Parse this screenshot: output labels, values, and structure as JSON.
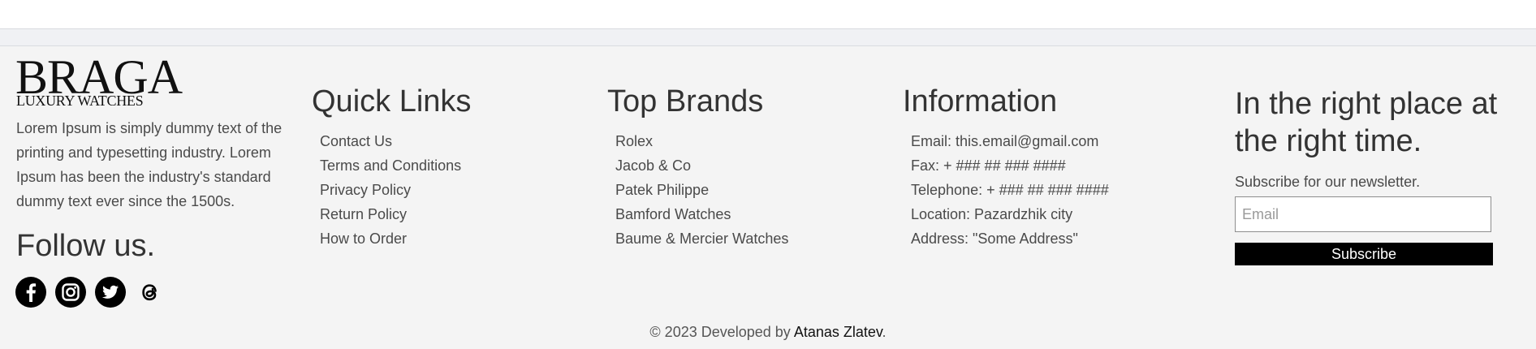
{
  "brand": {
    "logo_main": "BRAGA",
    "logo_sub": "LUXURY WATCHES",
    "about": "Lorem Ipsum is simply dummy text of the printing and typesetting industry. Lorem Ipsum has been the industry's standard dummy text ever since the 1500s."
  },
  "follow": {
    "heading": "Follow us.",
    "icons": [
      "facebook-icon",
      "instagram-icon",
      "twitter-icon",
      "threads-icon"
    ]
  },
  "quick_links": {
    "heading": "Quick Links",
    "items": [
      "Contact Us",
      "Terms and Conditions",
      "Privacy Policy",
      "Return Policy",
      "How to Order"
    ]
  },
  "top_brands": {
    "heading": "Top Brands",
    "items": [
      "Rolex",
      "Jacob & Co",
      "Patek Philippe",
      "Bamford Watches",
      "Baume & Mercier Watches"
    ]
  },
  "information": {
    "heading": "Information",
    "items": [
      "Email: this.email@gmail.com",
      "Fax: + ### ## ### ####",
      "Telephone: + ### ## ### ####",
      "Location: Pazardzhik city",
      "Address: \"Some Address\""
    ]
  },
  "newsletter": {
    "tagline": "In the right place at the right time.",
    "label": "Subscribe for our newsletter.",
    "email_placeholder": "Email",
    "email_value": "",
    "button": "Subscribe"
  },
  "copyright": {
    "prefix": "© 2023 Developed by ",
    "author": "Atanas Zlatev",
    "suffix": "."
  },
  "colors": {
    "footer_bg": "#f4f4f4",
    "button_bg": "#000000",
    "text": "#333333"
  }
}
